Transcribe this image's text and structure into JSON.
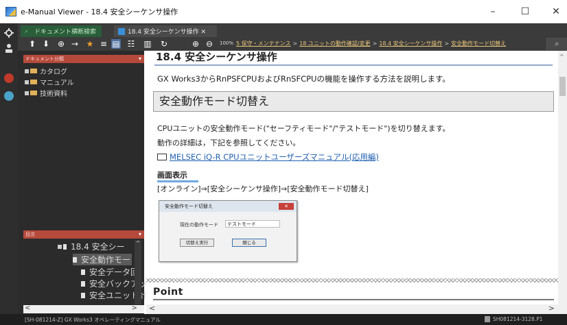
{
  "window": {
    "title": "e-Manual Viewer - 18.4 安全シーケンサ操作",
    "minimize": "–",
    "maximize": "☐",
    "close": "✕"
  },
  "tabs": [
    {
      "label": "ドキュメント横断検索"
    },
    {
      "label": "18.4 安全シーケンサ操作 ✕"
    }
  ],
  "toolbar": {
    "zoom": "100%",
    "breadcrumb": [
      "5 保守・メンテナンス",
      "18 ユニットの動作確認/変更",
      "18.4 安全シーケンサ操作",
      "安全動作モード切替え"
    ],
    "search_icon": "⌕"
  },
  "left_panel": {
    "doc_category_header": "ドキュメント分類",
    "doc_items": [
      "カタログ",
      "マニュアル",
      "技術資料"
    ],
    "toc_header": "目次",
    "toc_items": [
      "18.4 安全シー",
      "安全動作モー",
      "安全データ回",
      "安全バックアッ",
      "安全ユニット計"
    ]
  },
  "content": {
    "heading_cut": "18.4 安全シーケンサ操作",
    "intro": "GX Works3からRnPSFCPUおよびRnSFCPUの機能を操作する方法を説明します。",
    "section_title": "安全動作モード切替え",
    "para1": "CPUユニットの安全動作モード(\"セーフティモード\"/\"テストモード\")を切り替えます。",
    "para2": "動作の詳細は，下記を参照してください。",
    "link": "MELSEC iQ-R CPUユニットユーザーズマニュアル(応用編)",
    "screen_label": "画面表示",
    "menu_path": "[オンライン]⇒[安全シーケンサ操作]⇒[安全動作モード切替え]",
    "dialog": {
      "title": "安全動作モード切替え",
      "close": "✕",
      "row_label": "現在の動作モード",
      "row_value": "テストモード",
      "exec_button": "切替え実行",
      "close_button": "閉じる"
    },
    "point": "Point"
  },
  "statusbar": {
    "left": "[SH-081214-Z] GX Works3 オペレーティングマニュアル",
    "right": "SH081214-3128.P1"
  }
}
